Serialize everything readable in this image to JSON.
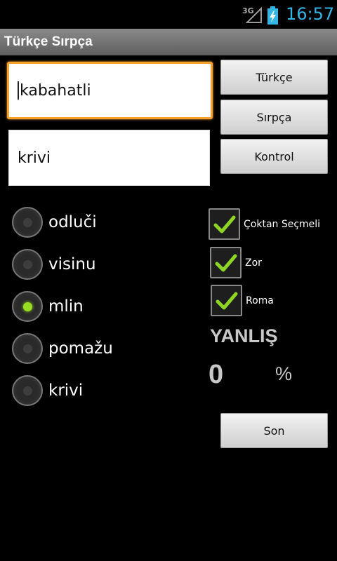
{
  "status_bar": {
    "network": "3G",
    "time": "16:57",
    "time_color": "#33b5e5",
    "icons": [
      "signal-icon",
      "battery-charging-icon"
    ]
  },
  "title_bar": {
    "title": "Türkçe Sırpça"
  },
  "inputs": {
    "word": {
      "value": "kabahatli",
      "focused": true,
      "focus_color": "#f7a12c"
    },
    "answer": {
      "value": "krivi"
    }
  },
  "buttons": {
    "turkish": "Türkçe",
    "serbian": "Sırpça",
    "check": "Kontrol",
    "end": "Son"
  },
  "options": [
    {
      "label": "odluči",
      "selected": false
    },
    {
      "label": "visinu",
      "selected": false
    },
    {
      "label": "mlin",
      "selected": true
    },
    {
      "label": "pomažu",
      "selected": false
    },
    {
      "label": "krivi",
      "selected": false
    }
  ],
  "settings": [
    {
      "label": "Çoktan Seçmeli",
      "checked": true
    },
    {
      "label": "Zor",
      "checked": true
    },
    {
      "label": "Roma",
      "checked": true
    }
  ],
  "result": {
    "label": "YANLIŞ",
    "score": "0",
    "unit": "%"
  },
  "colors": {
    "radio_selected": "#99dd22",
    "check_mark": "#8fd624"
  }
}
